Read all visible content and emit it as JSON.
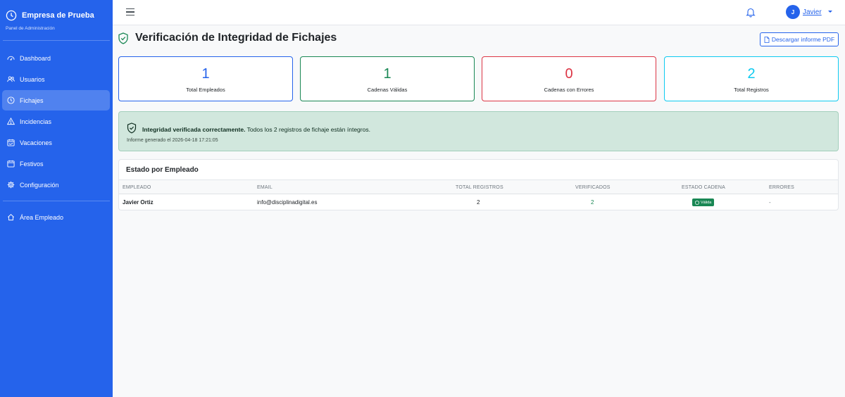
{
  "sidebar": {
    "brand_name": "Empresa de Prueba",
    "brand_sub": "Panel de Administración",
    "items": [
      {
        "label": "Dashboard",
        "icon": "dashboard-icon"
      },
      {
        "label": "Usuarios",
        "icon": "users-icon"
      },
      {
        "label": "Fichajes",
        "icon": "clock-icon",
        "active": true
      },
      {
        "label": "Incidencias",
        "icon": "warning-icon"
      },
      {
        "label": "Vacaciones",
        "icon": "calendar-icon"
      },
      {
        "label": "Festivos",
        "icon": "calendar-icon"
      },
      {
        "label": "Configuración",
        "icon": "gear-icon"
      }
    ],
    "employee_area": "Área Empleado"
  },
  "topbar": {
    "user_initial": "J",
    "user_name": "Javier"
  },
  "page": {
    "title": "Verificación de Integridad de Fichajes",
    "pdf_button": "Descargar informe PDF"
  },
  "stats": [
    {
      "value": "1",
      "label": "Total Empleados",
      "color": "#2563eb",
      "border": "#2563eb"
    },
    {
      "value": "1",
      "label": "Cadenas Válidas",
      "color": "#198754",
      "border": "#198754"
    },
    {
      "value": "0",
      "label": "Cadenas con Errores",
      "color": "#dc3545",
      "border": "#dc3545"
    },
    {
      "value": "2",
      "label": "Total Registros",
      "color": "#0dcaf0",
      "border": "#0dcaf0"
    }
  ],
  "alert": {
    "strong": "Integridad verificada correctamente.",
    "text": " Todos los 2 registros de fichaje están íntegros.",
    "generated": "Informe generado el 2026-04-18 17:21:05"
  },
  "table": {
    "title": "Estado por Empleado",
    "headers": [
      "EMPLEADO",
      "EMAIL",
      "TOTAL REGISTROS",
      "VERIFICADOS",
      "ESTADO CADENA",
      "ERRORES"
    ],
    "rows": [
      {
        "empleado": "Javier Ortiz",
        "email": "info@disciplinadigital.es",
        "total": "2",
        "verificados": "2",
        "estado": "Válida",
        "errores": "-"
      }
    ]
  }
}
